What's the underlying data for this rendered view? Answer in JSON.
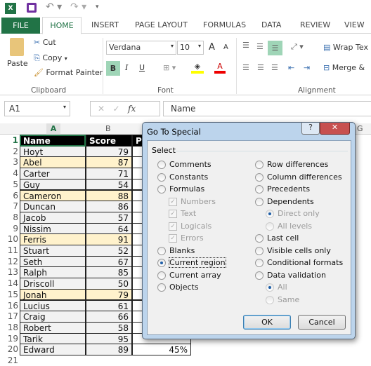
{
  "ribbon": {
    "tabs": [
      "FILE",
      "HOME",
      "INSERT",
      "PAGE LAYOUT",
      "FORMULAS",
      "DATA",
      "REVIEW",
      "VIEW"
    ],
    "clipboard": {
      "paste": "Paste",
      "cut": "Cut",
      "copy": "Copy",
      "format_painter": "Format Painter",
      "group": "Clipboard"
    },
    "font": {
      "name": "Verdana",
      "size": "10",
      "group": "Font",
      "bold": "B",
      "italic": "I",
      "underline": "U",
      "font_color": "A",
      "grow": "A",
      "shrink": "A"
    },
    "alignment": {
      "wrap": "Wrap Tex",
      "merge": "Merge &",
      "group": "Alignment"
    }
  },
  "formula_bar": {
    "name_box": "A1",
    "fx": "fx",
    "value": "Name"
  },
  "grid": {
    "columns": [
      "A",
      "B",
      "",
      "",
      "",
      "",
      "G"
    ],
    "header": [
      "Name",
      "Score",
      "P"
    ],
    "rows": [
      [
        "Hoyt",
        "79"
      ],
      [
        "Abel",
        "87"
      ],
      [
        "Carter",
        "71"
      ],
      [
        "Guy",
        "54"
      ],
      [
        "Cameron",
        "88"
      ],
      [
        "Duncan",
        "86"
      ],
      [
        "Jacob",
        "57"
      ],
      [
        "Nissim",
        "64"
      ],
      [
        "Ferris",
        "91"
      ],
      [
        "Stuart",
        "52"
      ],
      [
        "Seth",
        "67"
      ],
      [
        "Ralph",
        "85"
      ],
      [
        "Driscoll",
        "50"
      ],
      [
        "Jonah",
        "79"
      ],
      [
        "Lucius",
        "61"
      ],
      [
        "Craig",
        "66"
      ],
      [
        "Robert",
        "58"
      ],
      [
        "Tarik",
        "95"
      ],
      [
        "Edward",
        "89",
        "45%"
      ]
    ],
    "highlighted_rows": [
      3,
      6,
      10,
      15
    ],
    "highlight_color": "#fff2cc"
  },
  "dialog": {
    "title": "Go To Special",
    "help": "?",
    "close": "✕",
    "section": "Select",
    "left": [
      {
        "label": "Comments",
        "type": "radio"
      },
      {
        "label": "Constants",
        "type": "radio"
      },
      {
        "label": "Formulas",
        "type": "radio"
      },
      {
        "label": "Numbers",
        "type": "check",
        "disabled": true
      },
      {
        "label": "Text",
        "type": "check",
        "disabled": true
      },
      {
        "label": "Logicals",
        "type": "check",
        "disabled": true
      },
      {
        "label": "Errors",
        "type": "check",
        "disabled": true
      },
      {
        "label": "Blanks",
        "type": "radio"
      },
      {
        "label": "Current region",
        "type": "radio",
        "selected": true
      },
      {
        "label": "Current array",
        "type": "radio"
      },
      {
        "label": "Objects",
        "type": "radio"
      }
    ],
    "right": [
      {
        "label": "Row differences",
        "type": "radio"
      },
      {
        "label": "Column differences",
        "type": "radio"
      },
      {
        "label": "Precedents",
        "type": "radio"
      },
      {
        "label": "Dependents",
        "type": "radio"
      },
      {
        "label": "Direct only",
        "type": "subradio",
        "disabled": true,
        "selected": true
      },
      {
        "label": "All levels",
        "type": "subradio",
        "disabled": true
      },
      {
        "label": "Last cell",
        "type": "radio"
      },
      {
        "label": "Visible cells only",
        "type": "radio"
      },
      {
        "label": "Conditional formats",
        "type": "radio"
      },
      {
        "label": "Data validation",
        "type": "radio"
      },
      {
        "label": "All",
        "type": "subradio",
        "disabled": true,
        "selected": true
      },
      {
        "label": "Same",
        "type": "subradio",
        "disabled": true
      }
    ],
    "ok": "OK",
    "cancel": "Cancel"
  }
}
